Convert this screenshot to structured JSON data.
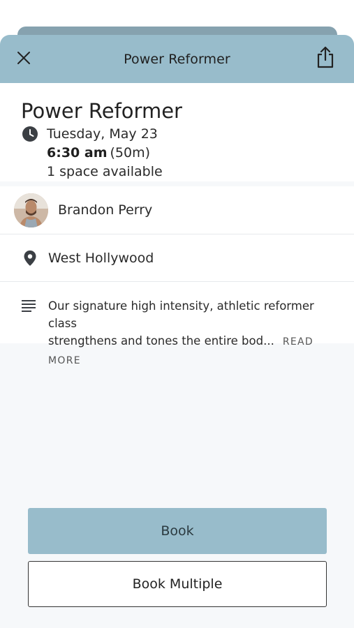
{
  "header": {
    "title": "Power Reformer",
    "close_icon": "close-icon",
    "share_icon": "share-icon"
  },
  "summary": {
    "title": "Power Reformer",
    "date": "Tuesday, May 23",
    "time": "6:30 am",
    "duration": "(50m)",
    "spaces": "1 space available",
    "clock_icon": "clock-icon"
  },
  "instructor": {
    "name": "Brandon Perry"
  },
  "location": {
    "name": "West Hollywood",
    "icon": "location-pin-icon"
  },
  "description": {
    "line1": "Our signature high intensity, athletic reformer class",
    "line2": "strengthens and tones the entire bod...",
    "read_more": "READ MORE",
    "icon": "menu-lines-icon"
  },
  "actions": {
    "book": "Book",
    "book_multiple": "Book Multiple"
  },
  "colors": {
    "accent": "#98bccb",
    "accent_dark": "#86a2af",
    "background": "#f6f8fa"
  }
}
